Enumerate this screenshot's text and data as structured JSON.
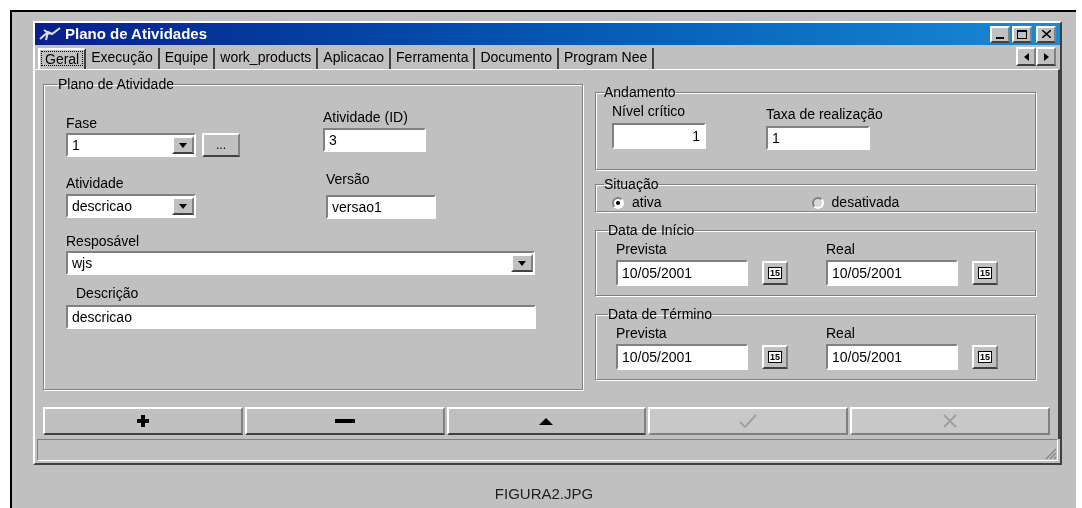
{
  "window": {
    "title": "Plano de Atividades"
  },
  "tabs": [
    {
      "label": "Geral",
      "selected": true
    },
    {
      "label": "Execução",
      "selected": false
    },
    {
      "label": "Equipe",
      "selected": false
    },
    {
      "label": "work_products",
      "selected": false
    },
    {
      "label": "Aplicacao",
      "selected": false
    },
    {
      "label": "Ferramenta",
      "selected": false
    },
    {
      "label": "Documento",
      "selected": false
    },
    {
      "label": "Program Nee",
      "selected": false
    }
  ],
  "plano": {
    "title": "Plano de Atividade",
    "fase": {
      "label": "Fase",
      "value": "1",
      "button": "..."
    },
    "atividade_id": {
      "label": "Atividade (ID)",
      "value": "3"
    },
    "atividade": {
      "label": "Atividade",
      "value": "descricao"
    },
    "versao": {
      "label": "Versão",
      "value": "versao1"
    },
    "responsavel": {
      "label": "Resposável",
      "value": "wjs"
    },
    "descricao": {
      "label": "Descrição",
      "value": "descricao"
    }
  },
  "andamento": {
    "title": "Andamento",
    "nivel_critico": {
      "label": "Nível crítico",
      "value": "1"
    },
    "taxa": {
      "label": "Taxa de realização",
      "value": "1"
    }
  },
  "situacao": {
    "title": "Situação",
    "options": [
      {
        "label": "ativa",
        "selected": true
      },
      {
        "label": "desativada",
        "selected": false
      }
    ]
  },
  "datas": [
    {
      "title": "Data de Início",
      "fields": [
        {
          "label": "Prevista",
          "value": "10/05/2001",
          "calendar": "15"
        },
        {
          "label": "Real",
          "value": "10/05/2001",
          "calendar": "15"
        }
      ]
    },
    {
      "title": "Data de Término",
      "fields": [
        {
          "label": "Prevista",
          "value": "10/05/2001",
          "calendar": "15"
        },
        {
          "label": "Real",
          "value": "10/05/2001",
          "calendar": "15"
        }
      ]
    }
  ],
  "toolbar": [
    {
      "kind": "add",
      "disabled": false
    },
    {
      "kind": "remove",
      "disabled": false
    },
    {
      "kind": "up",
      "disabled": false
    },
    {
      "kind": "confirm",
      "disabled": true
    },
    {
      "kind": "cancel",
      "disabled": true
    }
  ],
  "caption": "FIGURA2.JPG"
}
